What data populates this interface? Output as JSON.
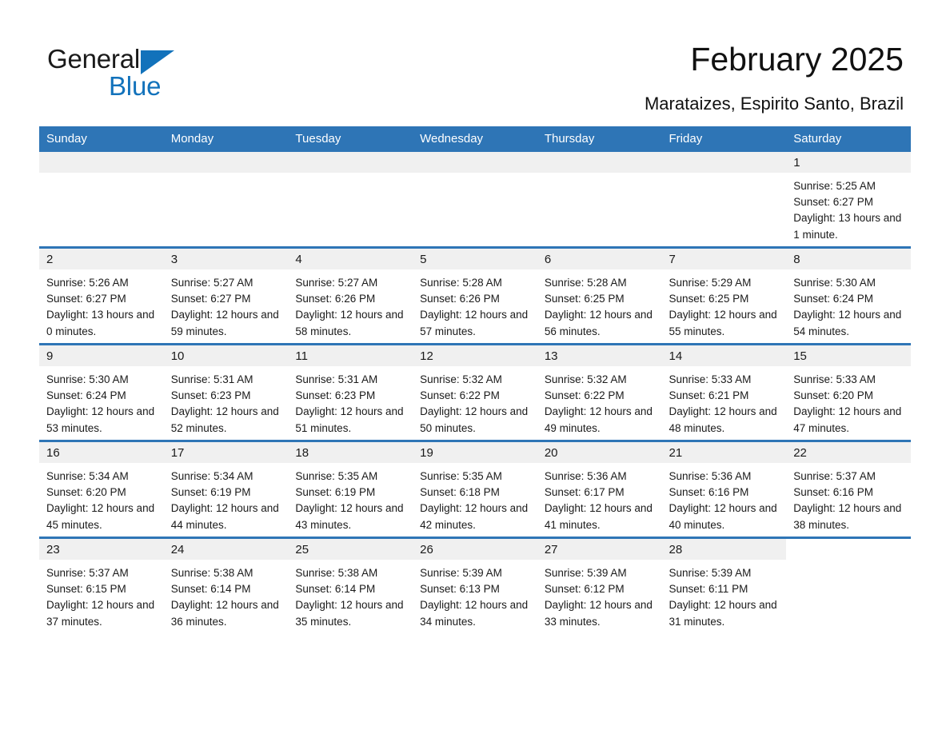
{
  "brand": {
    "word1": "General",
    "word2": "Blue",
    "triangle_color": "#1272bb"
  },
  "header": {
    "title": "February 2025",
    "subtitle": "Marataizes, Espirito Santo, Brazil",
    "accent_color": "#2e75b6"
  },
  "calendar": {
    "weekday_headers": [
      "Sunday",
      "Monday",
      "Tuesday",
      "Wednesday",
      "Thursday",
      "Friday",
      "Saturday"
    ],
    "labels": {
      "sunrise": "Sunrise:",
      "sunset": "Sunset:",
      "daylight": "Daylight:"
    },
    "weeks": [
      [
        {
          "day": "",
          "sunrise": "",
          "sunset": "",
          "daylight": ""
        },
        {
          "day": "",
          "sunrise": "",
          "sunset": "",
          "daylight": ""
        },
        {
          "day": "",
          "sunrise": "",
          "sunset": "",
          "daylight": ""
        },
        {
          "day": "",
          "sunrise": "",
          "sunset": "",
          "daylight": ""
        },
        {
          "day": "",
          "sunrise": "",
          "sunset": "",
          "daylight": ""
        },
        {
          "day": "",
          "sunrise": "",
          "sunset": "",
          "daylight": ""
        },
        {
          "day": "1",
          "sunrise": "Sunrise: 5:25 AM",
          "sunset": "Sunset: 6:27 PM",
          "daylight": "Daylight: 13 hours and 1 minute."
        }
      ],
      [
        {
          "day": "2",
          "sunrise": "Sunrise: 5:26 AM",
          "sunset": "Sunset: 6:27 PM",
          "daylight": "Daylight: 13 hours and 0 minutes."
        },
        {
          "day": "3",
          "sunrise": "Sunrise: 5:27 AM",
          "sunset": "Sunset: 6:27 PM",
          "daylight": "Daylight: 12 hours and 59 minutes."
        },
        {
          "day": "4",
          "sunrise": "Sunrise: 5:27 AM",
          "sunset": "Sunset: 6:26 PM",
          "daylight": "Daylight: 12 hours and 58 minutes."
        },
        {
          "day": "5",
          "sunrise": "Sunrise: 5:28 AM",
          "sunset": "Sunset: 6:26 PM",
          "daylight": "Daylight: 12 hours and 57 minutes."
        },
        {
          "day": "6",
          "sunrise": "Sunrise: 5:28 AM",
          "sunset": "Sunset: 6:25 PM",
          "daylight": "Daylight: 12 hours and 56 minutes."
        },
        {
          "day": "7",
          "sunrise": "Sunrise: 5:29 AM",
          "sunset": "Sunset: 6:25 PM",
          "daylight": "Daylight: 12 hours and 55 minutes."
        },
        {
          "day": "8",
          "sunrise": "Sunrise: 5:30 AM",
          "sunset": "Sunset: 6:24 PM",
          "daylight": "Daylight: 12 hours and 54 minutes."
        }
      ],
      [
        {
          "day": "9",
          "sunrise": "Sunrise: 5:30 AM",
          "sunset": "Sunset: 6:24 PM",
          "daylight": "Daylight: 12 hours and 53 minutes."
        },
        {
          "day": "10",
          "sunrise": "Sunrise: 5:31 AM",
          "sunset": "Sunset: 6:23 PM",
          "daylight": "Daylight: 12 hours and 52 minutes."
        },
        {
          "day": "11",
          "sunrise": "Sunrise: 5:31 AM",
          "sunset": "Sunset: 6:23 PM",
          "daylight": "Daylight: 12 hours and 51 minutes."
        },
        {
          "day": "12",
          "sunrise": "Sunrise: 5:32 AM",
          "sunset": "Sunset: 6:22 PM",
          "daylight": "Daylight: 12 hours and 50 minutes."
        },
        {
          "day": "13",
          "sunrise": "Sunrise: 5:32 AM",
          "sunset": "Sunset: 6:22 PM",
          "daylight": "Daylight: 12 hours and 49 minutes."
        },
        {
          "day": "14",
          "sunrise": "Sunrise: 5:33 AM",
          "sunset": "Sunset: 6:21 PM",
          "daylight": "Daylight: 12 hours and 48 minutes."
        },
        {
          "day": "15",
          "sunrise": "Sunrise: 5:33 AM",
          "sunset": "Sunset: 6:20 PM",
          "daylight": "Daylight: 12 hours and 47 minutes."
        }
      ],
      [
        {
          "day": "16",
          "sunrise": "Sunrise: 5:34 AM",
          "sunset": "Sunset: 6:20 PM",
          "daylight": "Daylight: 12 hours and 45 minutes."
        },
        {
          "day": "17",
          "sunrise": "Sunrise: 5:34 AM",
          "sunset": "Sunset: 6:19 PM",
          "daylight": "Daylight: 12 hours and 44 minutes."
        },
        {
          "day": "18",
          "sunrise": "Sunrise: 5:35 AM",
          "sunset": "Sunset: 6:19 PM",
          "daylight": "Daylight: 12 hours and 43 minutes."
        },
        {
          "day": "19",
          "sunrise": "Sunrise: 5:35 AM",
          "sunset": "Sunset: 6:18 PM",
          "daylight": "Daylight: 12 hours and 42 minutes."
        },
        {
          "day": "20",
          "sunrise": "Sunrise: 5:36 AM",
          "sunset": "Sunset: 6:17 PM",
          "daylight": "Daylight: 12 hours and 41 minutes."
        },
        {
          "day": "21",
          "sunrise": "Sunrise: 5:36 AM",
          "sunset": "Sunset: 6:16 PM",
          "daylight": "Daylight: 12 hours and 40 minutes."
        },
        {
          "day": "22",
          "sunrise": "Sunrise: 5:37 AM",
          "sunset": "Sunset: 6:16 PM",
          "daylight": "Daylight: 12 hours and 38 minutes."
        }
      ],
      [
        {
          "day": "23",
          "sunrise": "Sunrise: 5:37 AM",
          "sunset": "Sunset: 6:15 PM",
          "daylight": "Daylight: 12 hours and 37 minutes."
        },
        {
          "day": "24",
          "sunrise": "Sunrise: 5:38 AM",
          "sunset": "Sunset: 6:14 PM",
          "daylight": "Daylight: 12 hours and 36 minutes."
        },
        {
          "day": "25",
          "sunrise": "Sunrise: 5:38 AM",
          "sunset": "Sunset: 6:14 PM",
          "daylight": "Daylight: 12 hours and 35 minutes."
        },
        {
          "day": "26",
          "sunrise": "Sunrise: 5:39 AM",
          "sunset": "Sunset: 6:13 PM",
          "daylight": "Daylight: 12 hours and 34 minutes."
        },
        {
          "day": "27",
          "sunrise": "Sunrise: 5:39 AM",
          "sunset": "Sunset: 6:12 PM",
          "daylight": "Daylight: 12 hours and 33 minutes."
        },
        {
          "day": "28",
          "sunrise": "Sunrise: 5:39 AM",
          "sunset": "Sunset: 6:11 PM",
          "daylight": "Daylight: 12 hours and 31 minutes."
        },
        {
          "day": "",
          "sunrise": "",
          "sunset": "",
          "daylight": ""
        }
      ]
    ]
  }
}
